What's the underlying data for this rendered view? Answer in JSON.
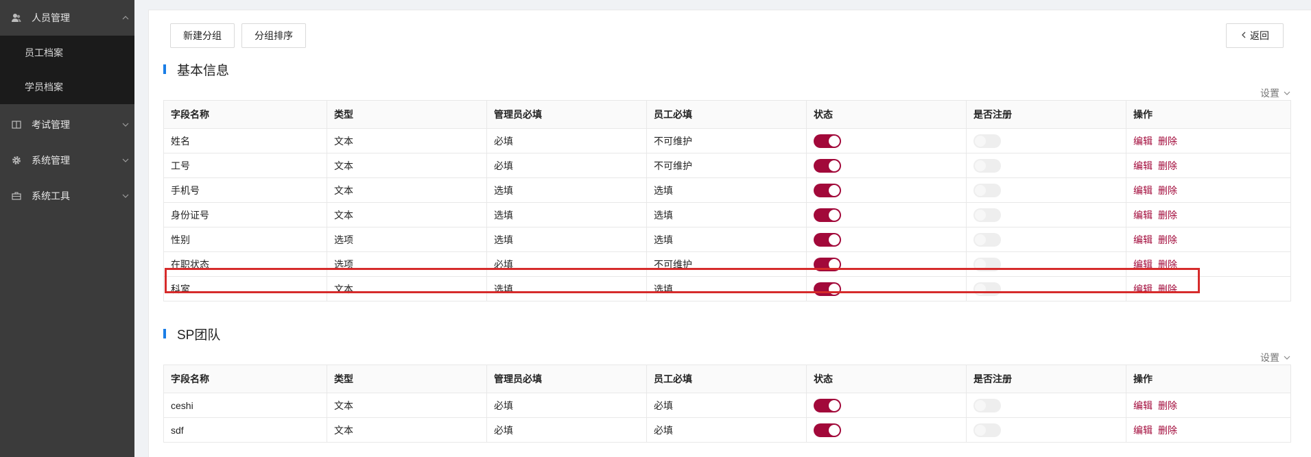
{
  "sidebar": {
    "groups": [
      {
        "label": "人员管理",
        "icon": "user-icon",
        "expanded": true,
        "items": [
          {
            "label": "员工档案"
          },
          {
            "label": "学员档案"
          }
        ]
      },
      {
        "label": "考试管理",
        "icon": "book-icon",
        "expanded": false
      },
      {
        "label": "系统管理",
        "icon": "gear-icon",
        "expanded": false
      },
      {
        "label": "系统工具",
        "icon": "toolbox-icon",
        "expanded": false
      }
    ]
  },
  "toolbar": {
    "new_group_label": "新建分组",
    "sort_group_label": "分组排序",
    "back_label": "返回"
  },
  "columns": [
    "字段名称",
    "类型",
    "管理员必填",
    "员工必填",
    "状态",
    "是否注册",
    "操作"
  ],
  "actions": {
    "edit": "编辑",
    "delete": "删除"
  },
  "colors": {
    "accent": "#a2093a",
    "section_bar": "#1b7ee6",
    "highlight": "#d62b2b"
  },
  "sections": [
    {
      "title": "基本信息",
      "settings_label": "设置",
      "rows": [
        {
          "name": "姓名",
          "type": "文本",
          "admin_required": "必填",
          "employee_required": "不可维护",
          "status_on": true,
          "register_on": false
        },
        {
          "name": "工号",
          "type": "文本",
          "admin_required": "必填",
          "employee_required": "不可维护",
          "status_on": true,
          "register_on": false
        },
        {
          "name": "手机号",
          "type": "文本",
          "admin_required": "选填",
          "employee_required": "选填",
          "status_on": true,
          "register_on": false
        },
        {
          "name": "身份证号",
          "type": "文本",
          "admin_required": "选填",
          "employee_required": "选填",
          "status_on": true,
          "register_on": false
        },
        {
          "name": "性别",
          "type": "选项",
          "admin_required": "选填",
          "employee_required": "选填",
          "status_on": true,
          "register_on": false
        },
        {
          "name": "在职状态",
          "type": "选项",
          "admin_required": "必填",
          "employee_required": "不可维护",
          "status_on": true,
          "register_on": false
        },
        {
          "name": "科室",
          "type": "文本",
          "admin_required": "选填",
          "employee_required": "选填",
          "status_on": true,
          "register_on": false
        }
      ]
    },
    {
      "title": "SP团队",
      "settings_label": "设置",
      "rows": [
        {
          "name": "ceshi",
          "type": "文本",
          "admin_required": "必填",
          "employee_required": "必填",
          "status_on": true,
          "register_on": false
        },
        {
          "name": "sdf",
          "type": "文本",
          "admin_required": "必填",
          "employee_required": "必填",
          "status_on": true,
          "register_on": false
        }
      ]
    }
  ]
}
